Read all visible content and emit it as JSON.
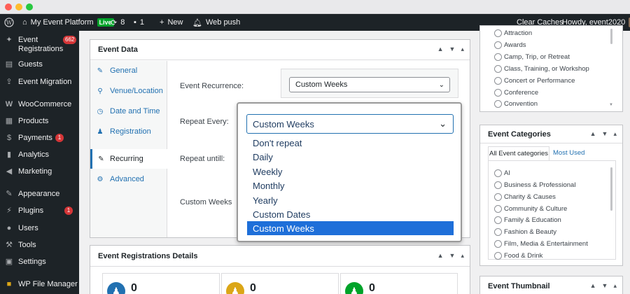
{
  "colors": {
    "admin_bar": "#1d2327",
    "accent": "#2271b1",
    "badge": "#d63638",
    "live": "#00a32a",
    "selected_option": "#1e6fd9"
  },
  "admin_bar": {
    "wp_icon": "wordpress-icon",
    "site_name": "My Event Platform",
    "live_badge": "Live",
    "updates_count": "8",
    "comments_count": "1",
    "new_label": "New",
    "web_push_label": "Web push",
    "clear_caches": "Clear Caches",
    "howdy": "Howdy, event2020"
  },
  "sidebar": {
    "items": [
      {
        "icon": "tickets-icon",
        "label": "Event Registrations",
        "badge": "662"
      },
      {
        "icon": "guests-icon",
        "label": "Guests",
        "badge": ""
      },
      {
        "icon": "migration-icon",
        "label": "Event Migration",
        "badge": ""
      },
      {
        "icon": "woocommerce-icon",
        "label": "WooCommerce",
        "badge": ""
      },
      {
        "icon": "products-icon",
        "label": "Products",
        "badge": ""
      },
      {
        "icon": "payments-icon",
        "label": "Payments",
        "badge": "1"
      },
      {
        "icon": "analytics-icon",
        "label": "Analytics",
        "badge": ""
      },
      {
        "icon": "marketing-icon",
        "label": "Marketing",
        "badge": ""
      },
      {
        "icon": "appearance-icon",
        "label": "Appearance",
        "badge": ""
      },
      {
        "icon": "plugins-icon",
        "label": "Plugins",
        "badge": "1"
      },
      {
        "icon": "users-icon",
        "label": "Users",
        "badge": ""
      },
      {
        "icon": "tools-icon",
        "label": "Tools",
        "badge": ""
      },
      {
        "icon": "settings-icon",
        "label": "Settings",
        "badge": ""
      },
      {
        "icon": "file-manager-icon",
        "label": "WP File Manager",
        "badge": ""
      }
    ]
  },
  "event_data": {
    "title": "Event Data",
    "tabs": [
      {
        "icon": "wrench-icon",
        "label": "General"
      },
      {
        "icon": "location-pin-icon",
        "label": "Venue/Location"
      },
      {
        "icon": "clock-icon",
        "label": "Date and Time"
      },
      {
        "icon": "person-icon",
        "label": "Registration"
      },
      {
        "icon": "wrench-icon",
        "label": "Recurring"
      },
      {
        "icon": "gear-icon",
        "label": "Advanced"
      }
    ],
    "fields": {
      "recurrence_label": "Event Recurrence:",
      "recurrence_value": "Custom Weeks",
      "repeat_every_label": "Repeat Every:",
      "repeat_until_label": "Repeat untill:",
      "custom_weeks_label": "Custom Weeks"
    }
  },
  "dropdown": {
    "selected": "Custom Weeks",
    "options": [
      "Don't repeat",
      "Daily",
      "Weekly",
      "Monthly",
      "Yearly",
      "Custom Dates",
      "Custom Weeks"
    ]
  },
  "registrations_details": {
    "title": "Event Registrations Details",
    "stats": [
      {
        "icon": "person-icon",
        "value": "0",
        "color": "#2271b1"
      },
      {
        "icon": "person-icon",
        "value": "0",
        "color": "#dba617"
      },
      {
        "icon": "person-icon",
        "value": "0",
        "color": "#00a32a"
      }
    ]
  },
  "type_panel": {
    "items": [
      "Attraction",
      "Awards",
      "Camp, Trip, or Retreat",
      "Class, Training, or Workshop",
      "Concert or Performance",
      "Conference",
      "Convention"
    ]
  },
  "categories_panel": {
    "title": "Event Categories",
    "tab_all": "All Event categories",
    "tab_most_used": "Most Used",
    "items": [
      "AI",
      "Business & Professional",
      "Charity & Causes",
      "Community & Culture",
      "Family & Education",
      "Fashion & Beauty",
      "Film, Media & Entertainment",
      "Food & Drink"
    ]
  },
  "thumbnail_panel": {
    "title": "Event Thumbnail"
  }
}
